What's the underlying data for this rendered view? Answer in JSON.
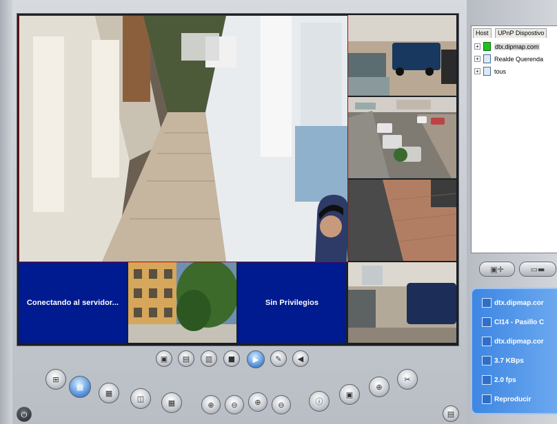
{
  "app": {
    "title": ""
  },
  "tree": {
    "tabs": [
      "Host",
      "UPnP Dispostivo"
    ],
    "items": [
      {
        "label": "dtx.dipmap.com",
        "state": "online"
      },
      {
        "label": "Realde Querenda",
        "state": "offline"
      },
      {
        "label": "tous",
        "state": "offline"
      }
    ]
  },
  "grid": {
    "connecting_text": "Conectando al servidor...",
    "no_privileges_text": "Sin Privilegios"
  },
  "info_panel": {
    "server": "dtx.dipmap.cor",
    "camera": "CI14 - Pasillo C",
    "host": "dtx.dipmap.cor",
    "bitrate": "3.7 KBps",
    "fps": "2.0 fps",
    "status": "Reproducir"
  },
  "colors": {
    "status_blue": "#001b8f",
    "selected_outline": "#bb0000",
    "info_panel_blue": "#3d86e3"
  }
}
